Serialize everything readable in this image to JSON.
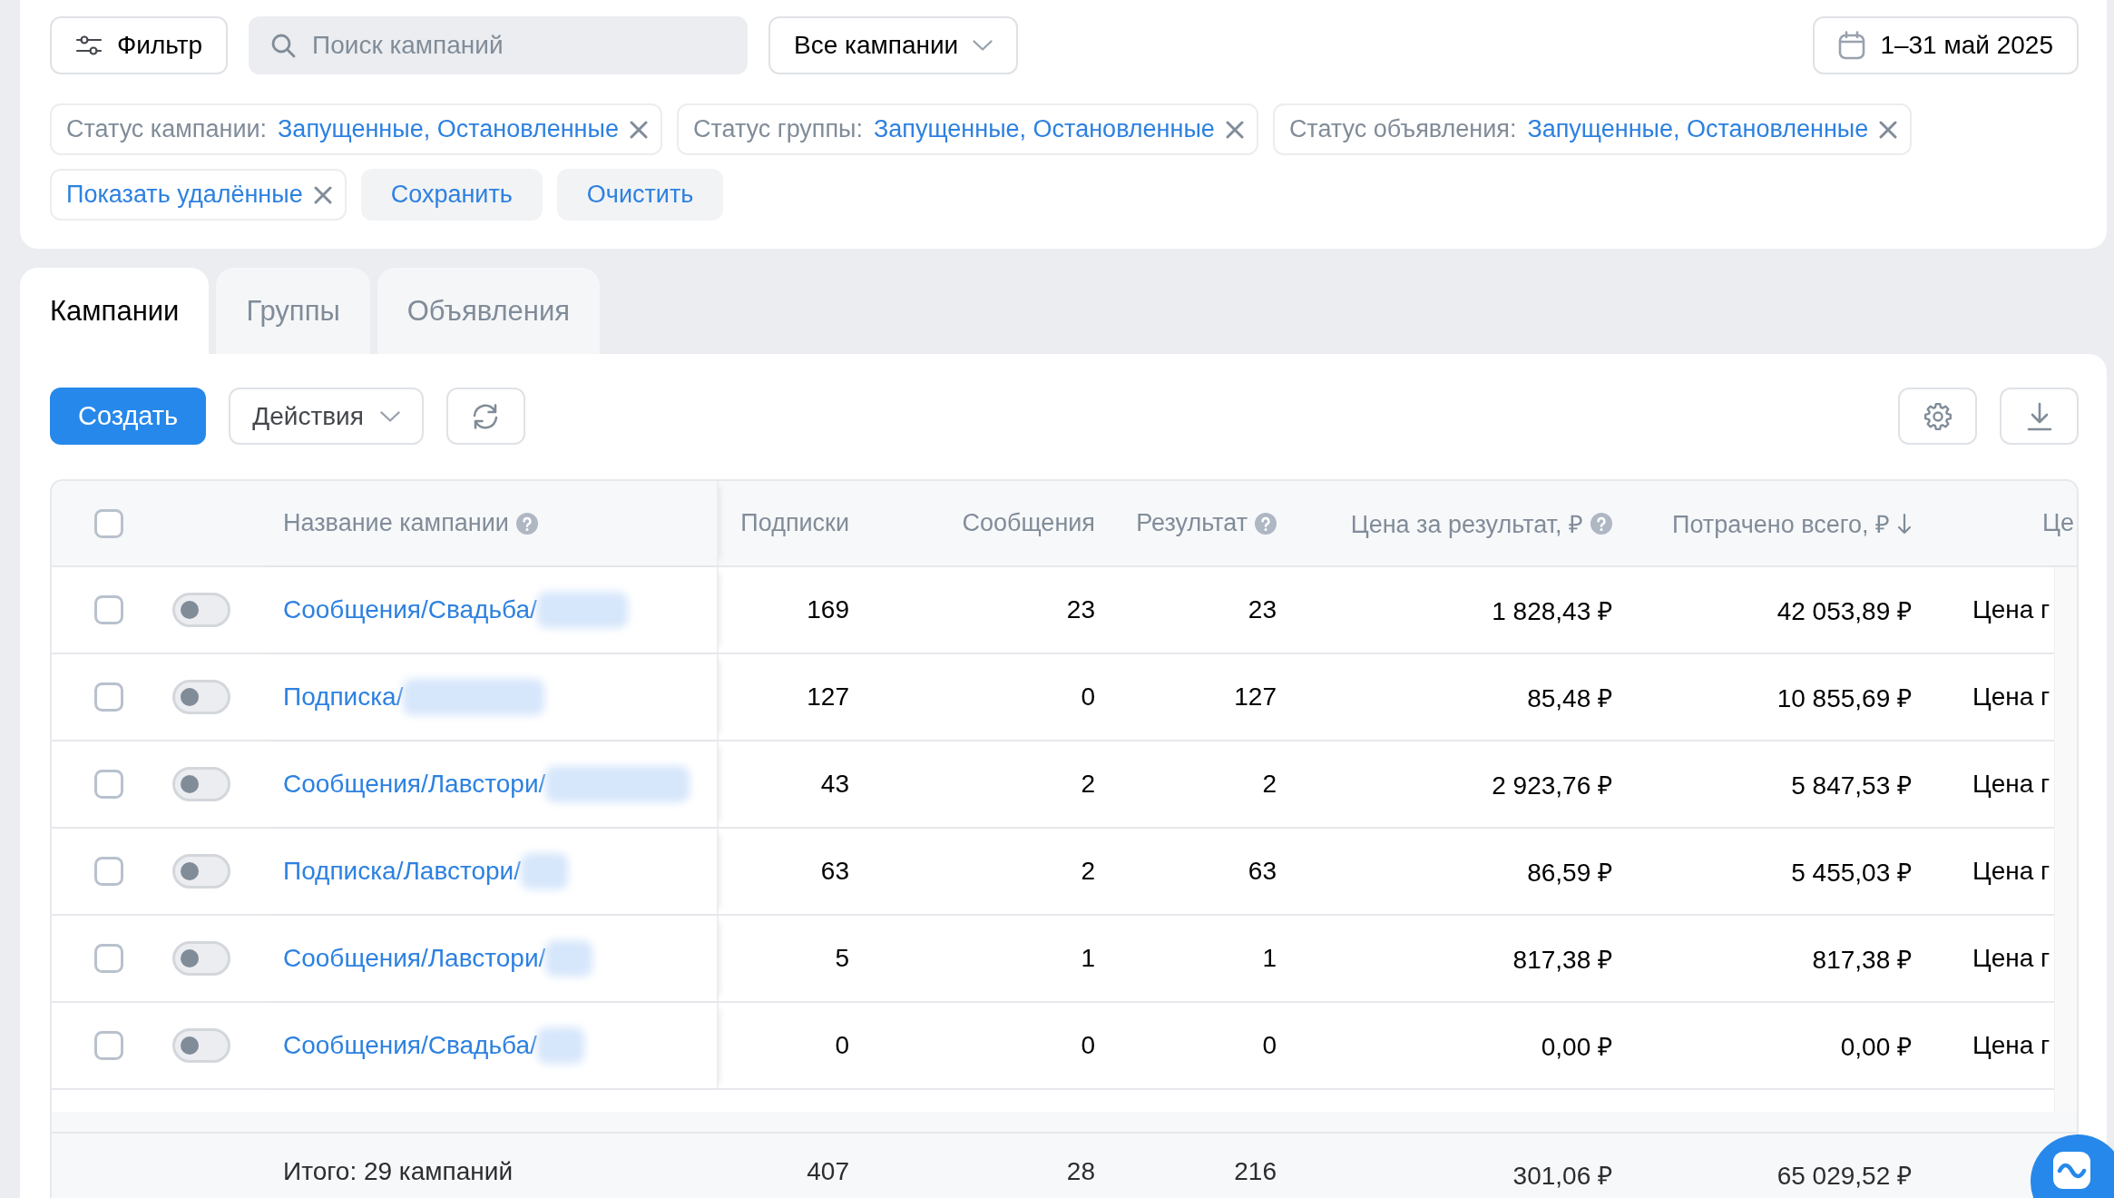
{
  "filter_bar": {
    "filter_button": "Фильтр",
    "search": {
      "placeholder": "Поиск кампаний"
    },
    "campaign_select": "Все кампании",
    "date_range": "1–31 май 2025",
    "chips": [
      {
        "label": "Статус кампании:",
        "value": "Запущенные, Остановленные"
      },
      {
        "label": "Статус группы:",
        "value": "Запущенные, Остановленные"
      },
      {
        "label": "Статус объявления:",
        "value": "Запущенные, Остановленные"
      },
      {
        "value": "Показать удалённые"
      }
    ],
    "actions": [
      "Сохранить",
      "Очистить"
    ]
  },
  "tabs": [
    {
      "label": "Кампании",
      "selected": true
    },
    {
      "label": "Группы",
      "selected": false
    },
    {
      "label": "Объявления",
      "selected": false
    }
  ],
  "toolbar": {
    "create_button": "Создать",
    "actions_menu": "Действия"
  },
  "table": {
    "header_checkbox": {
      "checked": false
    },
    "columns": [
      {
        "label": "Название кампании",
        "help": true,
        "sorted": false
      },
      {
        "label": "Подписки",
        "help": false,
        "sorted": false
      },
      {
        "label": "Сообщения",
        "help": false,
        "sorted": false
      },
      {
        "label": "Результат",
        "help": true,
        "sorted": false
      },
      {
        "label": "Цена за результат, ₽",
        "help": true,
        "sorted": false
      },
      {
        "label": "Потрачено всего, ₽",
        "help": false,
        "sorted": true
      },
      {
        "label": "Це",
        "help": false,
        "sorted": false
      }
    ],
    "rows": [
      {
        "checked": false,
        "on": false,
        "redacted": true,
        "cells": [
          "Сообщения/Свадьба/",
          "169",
          "23",
          "23",
          "1 828,43 ₽",
          "42 053,89 ₽",
          "Цена г"
        ]
      },
      {
        "checked": false,
        "on": false,
        "redacted": true,
        "cells": [
          "Подписка/",
          "127",
          "0",
          "127",
          "85,48 ₽",
          "10 855,69 ₽",
          "Цена г"
        ]
      },
      {
        "checked": false,
        "on": false,
        "redacted": true,
        "cells": [
          "Сообщения/Лавстори/",
          "43",
          "2",
          "2",
          "2 923,76 ₽",
          "5 847,53 ₽",
          "Цена г"
        ]
      },
      {
        "checked": false,
        "on": false,
        "redacted": true,
        "cells": [
          "Подписка/Лавстори/",
          "63",
          "2",
          "63",
          "86,59 ₽",
          "5 455,03 ₽",
          "Цена г"
        ]
      },
      {
        "checked": false,
        "on": false,
        "redacted": true,
        "cells": [
          "Сообщения/Лавстори/",
          "5",
          "1",
          "1",
          "817,38 ₽",
          "817,38 ₽",
          "Цена г"
        ]
      },
      {
        "checked": false,
        "on": false,
        "redacted": true,
        "cells": [
          "Сообщения/Свадьба/",
          "0",
          "0",
          "0",
          "0,00 ₽",
          "0,00 ₽",
          "Цена г"
        ]
      }
    ],
    "totals": {
      "cells": [
        "Итого: 29 кампаний",
        "407",
        "28",
        "216",
        "301,06 ₽",
        "65 029,52 ₽"
      ]
    }
  }
}
